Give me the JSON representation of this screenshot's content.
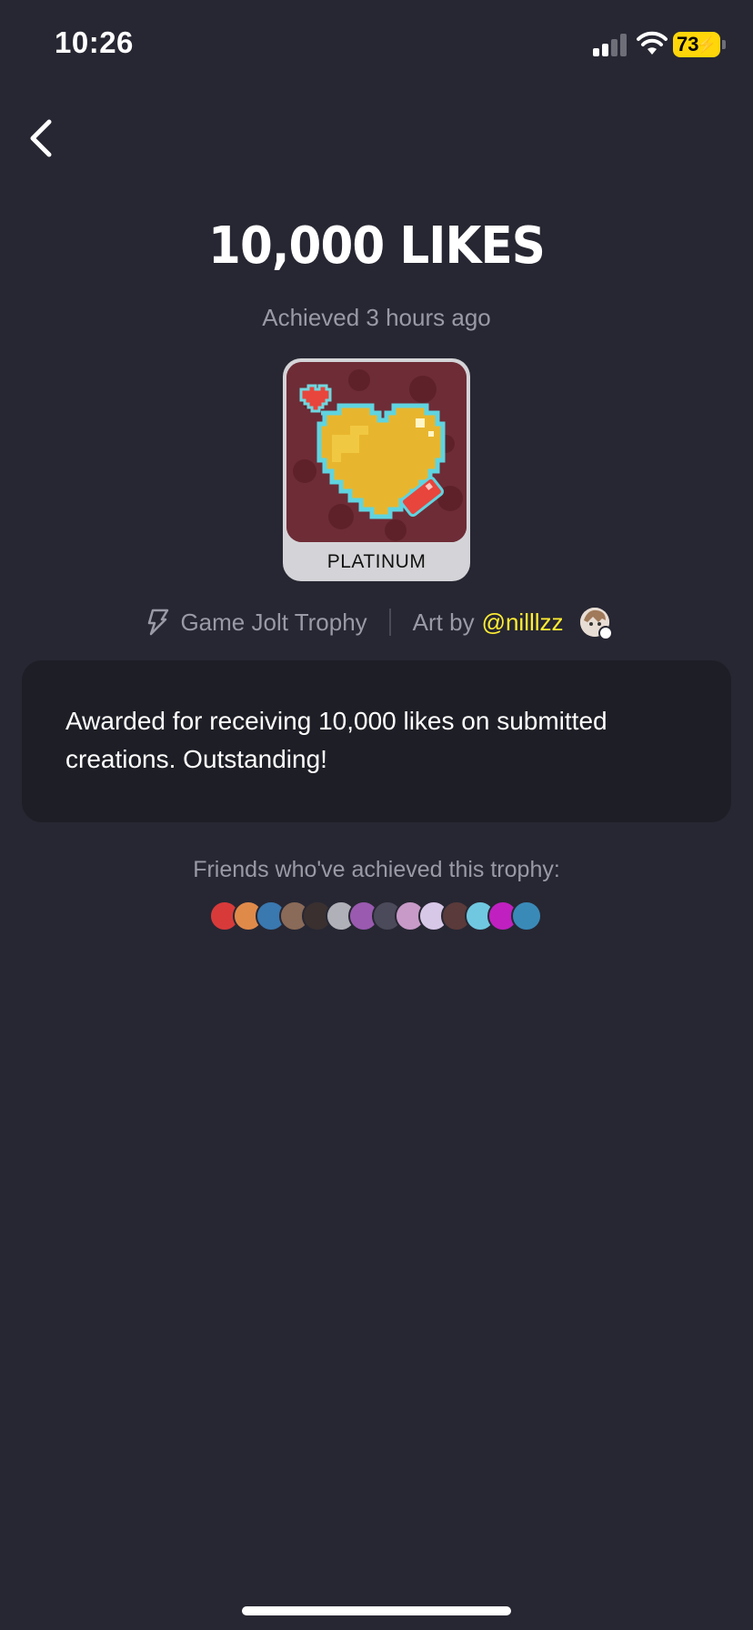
{
  "status_bar": {
    "time": "10:26",
    "battery": "73",
    "battery_color": "#ffd60a"
  },
  "header": {
    "back_icon": "chevron-left-icon"
  },
  "trophy": {
    "title": "10,000 LIKES",
    "achieved": "Achieved 3 hours ago",
    "tier": "PLATINUM",
    "source": "Game Jolt Trophy",
    "art_by_label": "Art by",
    "artist": "@nilllzz",
    "description": "Awarded for receiving 10,000 likes on submitted creations. Outstanding!"
  },
  "friends": {
    "label": "Friends who've achieved this trophy:",
    "avatars": [
      "#d83a3a",
      "#e08a4a",
      "#3a78b0",
      "#8a6a58",
      "#3a3030",
      "#b0b0b8",
      "#9a5ab0",
      "#4a4a5a",
      "#c89ac8",
      "#d8c8e8",
      "#5a3a3a",
      "#70c8e0",
      "#c020c0",
      "#3a8ab8"
    ]
  },
  "colors": {
    "background": "#272733",
    "card": "#1e1e26",
    "accent": "#ffee33",
    "muted_text": "#9a9aa6"
  }
}
